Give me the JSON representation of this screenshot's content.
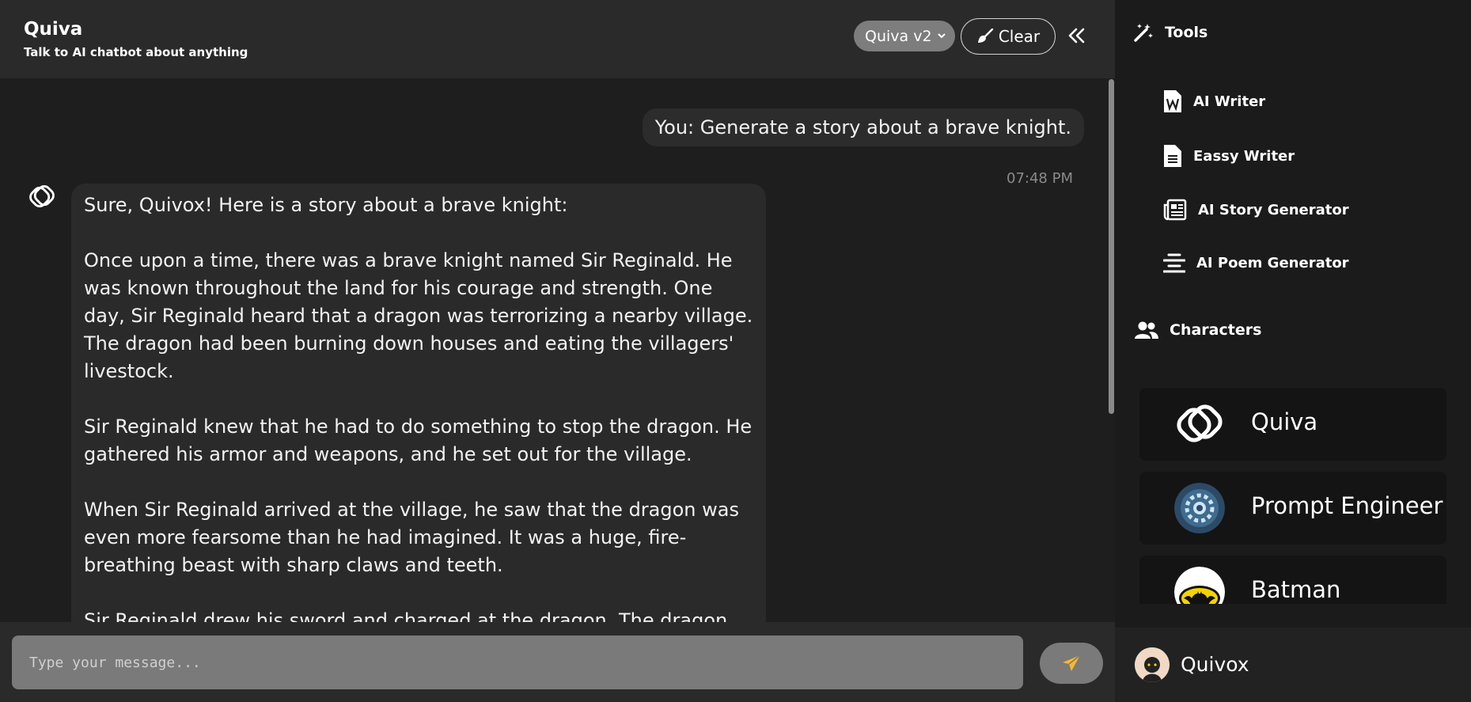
{
  "header": {
    "title": "Quiva",
    "subtitle": "Talk to AI chatbot about anything",
    "model_select": "Quiva v2",
    "clear_label": "Clear"
  },
  "chat": {
    "user_message": "You: Generate a story about a brave knight.",
    "timestamp": "07:48 PM",
    "bot_paragraphs": [
      "Sure, Quivox! Here is a story about a brave knight:",
      "Once upon a time, there was a brave knight named Sir Reginald. He was known throughout the land for his courage and strength. One day, Sir Reginald heard that a dragon was terrorizing a nearby village. The dragon had been burning down houses and eating the villagers' livestock.",
      "Sir Reginald knew that he had to do something to stop the dragon. He gathered his armor and weapons, and he set out for the village.",
      "When Sir Reginald arrived at the village, he saw that the dragon was even more fearsome than he had imagined. It was a huge, fire-breathing beast with sharp claws and teeth.",
      "Sir Reginald drew his sword and charged at the dragon. The dragon"
    ]
  },
  "composer": {
    "placeholder": "Type your message..."
  },
  "sidebar": {
    "tools_heading": "Tools",
    "tools": [
      {
        "label": "AI Writer",
        "icon": "word-doc-icon"
      },
      {
        "label": "Eassy Writer",
        "icon": "document-icon"
      },
      {
        "label": "AI Story Generator",
        "icon": "newspaper-icon"
      },
      {
        "label": "AI Poem Generator",
        "icon": "align-center-icon"
      }
    ],
    "characters_heading": "Characters",
    "characters": [
      {
        "name": "Quiva"
      },
      {
        "name": "Prompt Engineer"
      },
      {
        "name": "Batman"
      }
    ],
    "user_name": "Quivox"
  },
  "colors": {
    "accent": "#f5b82e",
    "panel": "#2a2a2a",
    "background": "#1e1e1e"
  }
}
